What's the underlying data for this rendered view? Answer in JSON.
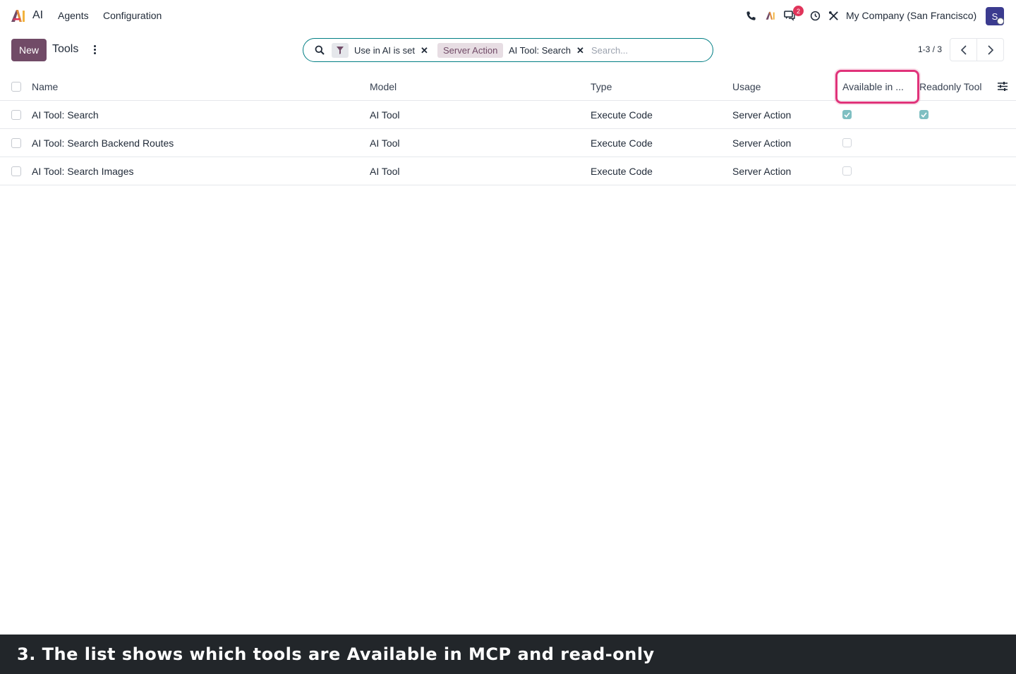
{
  "app": {
    "name": "AI",
    "brand_colors": {
      "primary": "#714b67",
      "accent": "#017e84",
      "badge": "#e0345a"
    }
  },
  "nav": {
    "items": [
      {
        "label": "Agents"
      },
      {
        "label": "Configuration"
      }
    ]
  },
  "systray": {
    "icons": [
      "phone-icon",
      "ai-icon",
      "messages-icon",
      "clock-icon",
      "debug-icon"
    ],
    "message_count": "2",
    "company": "My Company (San Francisco)",
    "user_initial": "S"
  },
  "control_panel": {
    "new_label": "New",
    "title": "Tools",
    "pager": "1-3 / 3"
  },
  "search": {
    "facets": [
      {
        "icon": "filter-icon",
        "label": "Use in AI is set"
      },
      {
        "tag": "Server Action",
        "label": "AI Tool: Search"
      }
    ],
    "placeholder": "Search..."
  },
  "table": {
    "columns": [
      "Name",
      "Model",
      "Type",
      "Usage",
      "Available in ...",
      "Readonly Tool"
    ],
    "rows": [
      {
        "name": "AI Tool: Search",
        "model": "AI Tool",
        "type": "Execute Code",
        "usage": "Server Action",
        "available_in_mcp": true,
        "readonly": true
      },
      {
        "name": "AI Tool: Search Backend Routes",
        "model": "AI Tool",
        "type": "Execute Code",
        "usage": "Server Action",
        "available_in_mcp": false,
        "readonly": null
      },
      {
        "name": "AI Tool: Search Images",
        "model": "AI Tool",
        "type": "Execute Code",
        "usage": "Server Action",
        "available_in_mcp": false,
        "readonly": null
      }
    ]
  },
  "caption": "3. The list shows which tools are Available in MCP and read-only"
}
